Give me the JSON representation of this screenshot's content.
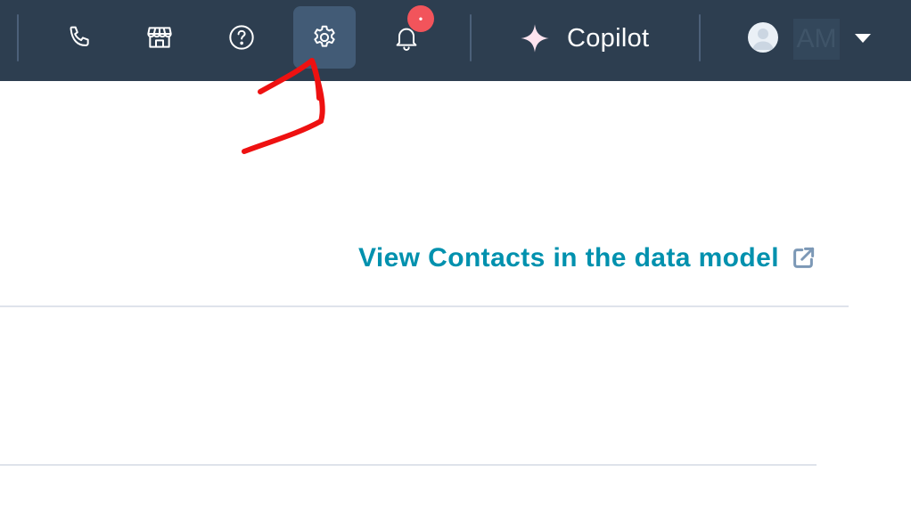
{
  "topbar": {
    "background": "#2d3e50",
    "items": [
      {
        "name": "calling-button",
        "icon": "phone-icon"
      },
      {
        "name": "marketplace-button",
        "icon": "storefront-icon"
      },
      {
        "name": "help-button",
        "icon": "question-circle-icon"
      },
      {
        "name": "settings-button",
        "icon": "gear-icon",
        "active": true
      },
      {
        "name": "notifications-button",
        "icon": "bell-icon"
      }
    ],
    "notification_badge": "•",
    "copilot_label": "Copilot",
    "user_initials": "AM"
  },
  "main": {
    "data_model_link": "View Contacts in the data model",
    "link_color": "#0091ae"
  },
  "annotation": {
    "color": "#ee1111",
    "points_to": "settings-button"
  }
}
